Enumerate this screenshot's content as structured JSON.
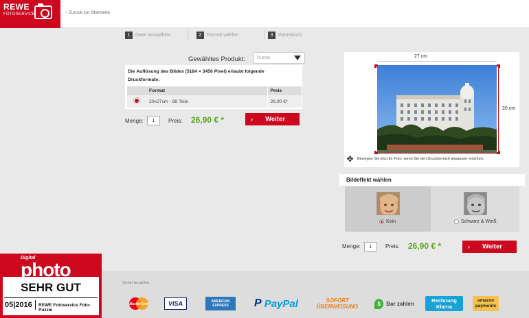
{
  "header": {
    "logo_main": "REWE",
    "logo_sub": "FOTOSERVICE",
    "back_link": "‹ Zurück zur Startseite"
  },
  "steps": [
    {
      "num": "1",
      "label": "Datei auswählen"
    },
    {
      "num": "2",
      "label": "Format wählen"
    },
    {
      "num": "3",
      "label": "Warenkorb"
    }
  ],
  "product": {
    "label": "Gewähltes Produkt:",
    "selected": "Puzzle",
    "info": "Die Auflösung des Bildes (5184 × 3456 Pixel) erlaubt folgende Druckformate:",
    "table": {
      "headers": [
        "",
        "Format",
        "Preis"
      ],
      "rows": [
        {
          "format": "20x27cm - 88 Teile",
          "price": "26,90 €*",
          "selected": true
        }
      ]
    },
    "qty_label": "Menge:",
    "qty": "1",
    "price_label": "Preis:",
    "price": "26,90 € *",
    "button": "Weiter"
  },
  "preview": {
    "width_label": "27 cm",
    "height_label": "20 cm",
    "hint": "Bewegen Sie jetzt Ihr Foto, wenn Sie den Druckbereich anpassen möchten."
  },
  "effects": {
    "title": "Bildeffekt wählen",
    "options": [
      {
        "label": "Kein",
        "selected": true
      },
      {
        "label": "Schwarz & Weiß",
        "selected": false
      }
    ],
    "qty_label": "Menge:",
    "qty": "1",
    "price_label": "Preis:",
    "price": "26,90 € *",
    "button": "Weiter"
  },
  "badge": {
    "top": "Digital",
    "brand": "photo",
    "grade": "SEHR GUT",
    "date": "05|2016",
    "product": "REWE Fotoservice Foto-Puzzle"
  },
  "payment": {
    "title": "Sicher bezahlen",
    "methods": [
      "MasterCard",
      "VISA",
      "AMERICAN EXPRESS",
      "PayPal",
      "SOFORT ÜBERWEISUNG",
      "Bar zahlen",
      "Rechnung Klarna",
      "amazon payments"
    ]
  },
  "colors": {
    "brand_red": "#cc071e",
    "price_green": "#5aa61f",
    "background": "#e9e9e9"
  }
}
